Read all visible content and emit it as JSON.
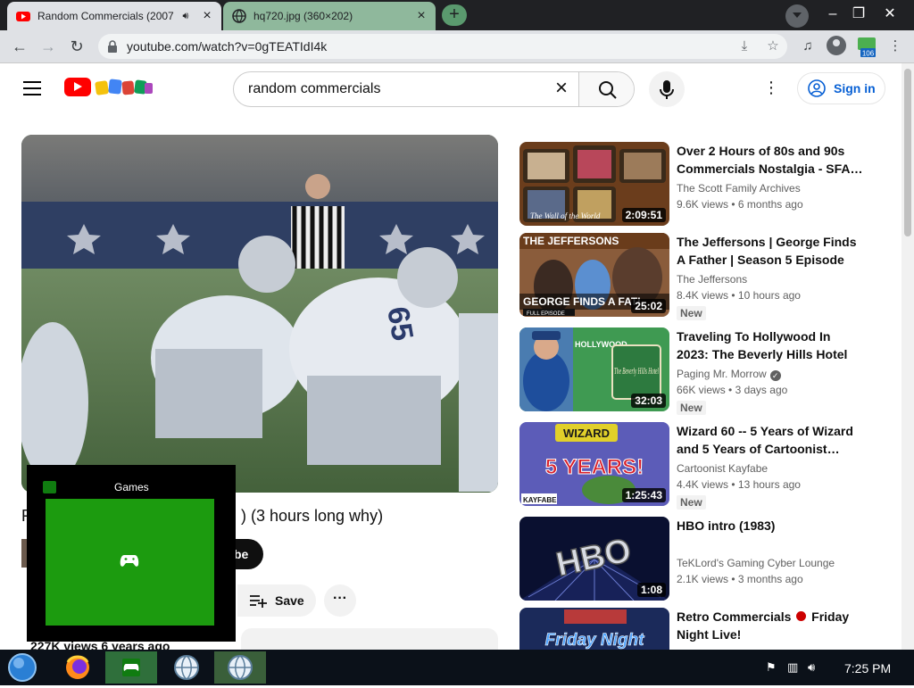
{
  "browser": {
    "tabs": [
      {
        "title": "Random Commercials (2007",
        "active": true
      },
      {
        "title": "hq720.jpg (360×202)",
        "active": false
      }
    ],
    "new_tab": "+",
    "url": "youtube.com/watch?v=0gTEATIdI4k",
    "colors": {
      "tabstrip": "#202124",
      "active_tab": "#dfe1e5",
      "inactive_tab": "#8fb89c"
    },
    "extension_badge": "106"
  },
  "youtube": {
    "search_query": "random commercials",
    "sign_in": "Sign in",
    "video": {
      "title_visible_first_char": "R",
      "title_visible_tail": ") (3 hours long why)",
      "subscribe_visible": "be",
      "save_label": "Save",
      "views_visible": "227K views  6 years ago"
    },
    "recommendations": [
      {
        "title": "Over 2 Hours of 80s and 90s Commercials Nostalgia - SFA…",
        "channel": "The Scott Family Archives",
        "verified": false,
        "views": "9.6K views",
        "age": "6 months ago",
        "duration": "2:09:51",
        "badge": ""
      },
      {
        "title": "The Jeffersons | George Finds A Father | Season 5 Episode 516…",
        "channel": "The Jeffersons",
        "verified": false,
        "views": "8.4K views",
        "age": "10 hours ago",
        "duration": "25:02",
        "badge": "New"
      },
      {
        "title": "Traveling To Hollywood In 2023: The Beverly Hills Hotel &…",
        "channel": "Paging Mr. Morrow",
        "verified": true,
        "views": "66K views",
        "age": "3 days ago",
        "duration": "32:03",
        "badge": "New"
      },
      {
        "title": "Wizard 60 -- 5 Years of Wizard and 5 Years of Cartoonist…",
        "channel": "Cartoonist Kayfabe",
        "verified": false,
        "views": "4.4K views",
        "age": "13 hours ago",
        "duration": "1:25:43",
        "badge": "New"
      },
      {
        "title": "HBO intro (1983)",
        "channel": "TeKLord's Gaming Cyber Lounge",
        "verified": false,
        "views": "2.1K views",
        "age": "3 months ago",
        "duration": "1:08",
        "badge": ""
      },
      {
        "title_before": "Retro Commercials",
        "title_after": "Friday Night Live!",
        "channel": "",
        "views": "",
        "age": "",
        "duration": "",
        "badge": ""
      }
    ],
    "thumb_text": {
      "jeffersons_top": "THE JEFFERSONS",
      "jeffersons_bottom": "GEORGE FINDS A FATI",
      "jeffersons_full": "FULL EPISODE",
      "hollywood_sign": "HOLLYWOOD",
      "beverly": "The Beverly Hills Hotel",
      "wizard_top": "WIZARD",
      "wizard_years": "5 YEARS!",
      "wizard_kayfabe": "KAYFABE",
      "hbo": "HBO",
      "friday": "Friday Night",
      "sfa_caption": "The Wall of the World"
    }
  },
  "games_overlay": {
    "title": "Games",
    "color": "#1c9b0f"
  },
  "taskbar": {
    "time": "7:25 PM"
  }
}
